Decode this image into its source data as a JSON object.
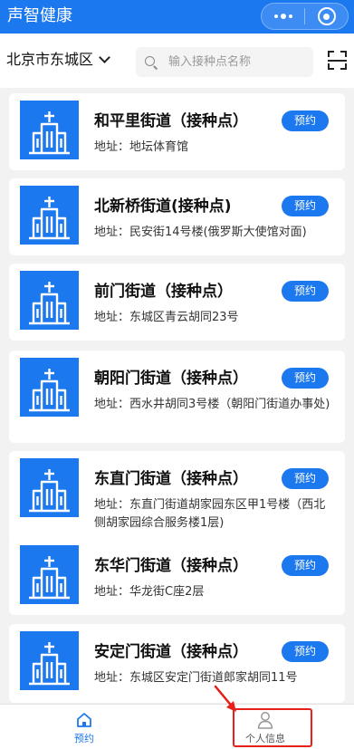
{
  "app": {
    "title": "声智健康"
  },
  "capsule": {
    "more_icon": "more-dots-icon",
    "close_icon": "target-close-icon"
  },
  "search_bar": {
    "district": "北京市东城区",
    "placeholder": "输入接种点名称",
    "scan_icon": "scan-icon"
  },
  "sites": [
    {
      "name": "和平里街道（接种点）",
      "address": "地址：地坛体育馆",
      "button": "预约"
    },
    {
      "name": "北新桥街道(接种点)",
      "address": "地址：民安街14号楼(俄罗斯大使馆对面)",
      "button": "预约"
    },
    {
      "name": "前门街道（接种点）",
      "address": "地址：东城区青云胡同23号",
      "button": "预约"
    },
    {
      "name": "朝阳门街道（接种点）",
      "address": "地址：西水井胡同3号楼（朝阳门街道办事处)",
      "button": "预约"
    },
    {
      "name": "东直门街道（接种点）",
      "address": "地址：东直门街道胡家园东区甲1号楼（西北侧胡家园综合服务楼1层)",
      "button": "预约"
    },
    {
      "name": "东华门街道（接种点）",
      "address": "地址：华龙街C座2层",
      "button": "预约"
    },
    {
      "name": "安定门街道（接种点）",
      "address": "地址：东城区安定门街道郎家胡同11号",
      "button": "预约"
    }
  ],
  "bottom_nav": {
    "items": [
      {
        "label": "预约",
        "icon": "home-icon",
        "active": true
      },
      {
        "label": "个人信息",
        "icon": "person-icon",
        "active": false
      }
    ]
  },
  "colors": {
    "brand": "#1c78ee",
    "annotation": "#e8201a"
  }
}
